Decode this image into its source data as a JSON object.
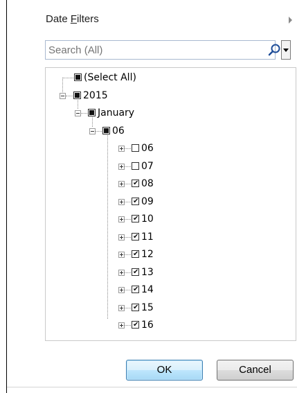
{
  "menu": {
    "date_filters_prefix": "Date ",
    "date_filters_accel": "F",
    "date_filters_suffix": "ilters"
  },
  "search": {
    "placeholder": "Search (All)",
    "value": ""
  },
  "tree": {
    "select_all": {
      "label": "(Select All)",
      "state": "partial"
    },
    "year": {
      "label": "2015",
      "state": "partial",
      "expanded": true
    },
    "month": {
      "label": "January",
      "state": "partial",
      "expanded": true
    },
    "day": {
      "label": "06",
      "state": "partial",
      "expanded": true
    },
    "children": [
      {
        "label": "06",
        "state": "unchecked"
      },
      {
        "label": "07",
        "state": "unchecked"
      },
      {
        "label": "08",
        "state": "checked"
      },
      {
        "label": "09",
        "state": "checked"
      },
      {
        "label": "10",
        "state": "checked"
      },
      {
        "label": "11",
        "state": "checked"
      },
      {
        "label": "12",
        "state": "checked"
      },
      {
        "label": "13",
        "state": "checked"
      },
      {
        "label": "14",
        "state": "checked"
      },
      {
        "label": "15",
        "state": "checked"
      },
      {
        "label": "16",
        "state": "checked"
      }
    ]
  },
  "buttons": {
    "ok": "OK",
    "cancel": "Cancel"
  },
  "icons": {
    "search": "search-icon",
    "dropdown": "chevron-down-icon",
    "submenu": "chevron-right-icon",
    "checkmark": "✔"
  },
  "colors": {
    "ok_border": "#3c7fb1",
    "search_border": "#a9b9d0"
  }
}
